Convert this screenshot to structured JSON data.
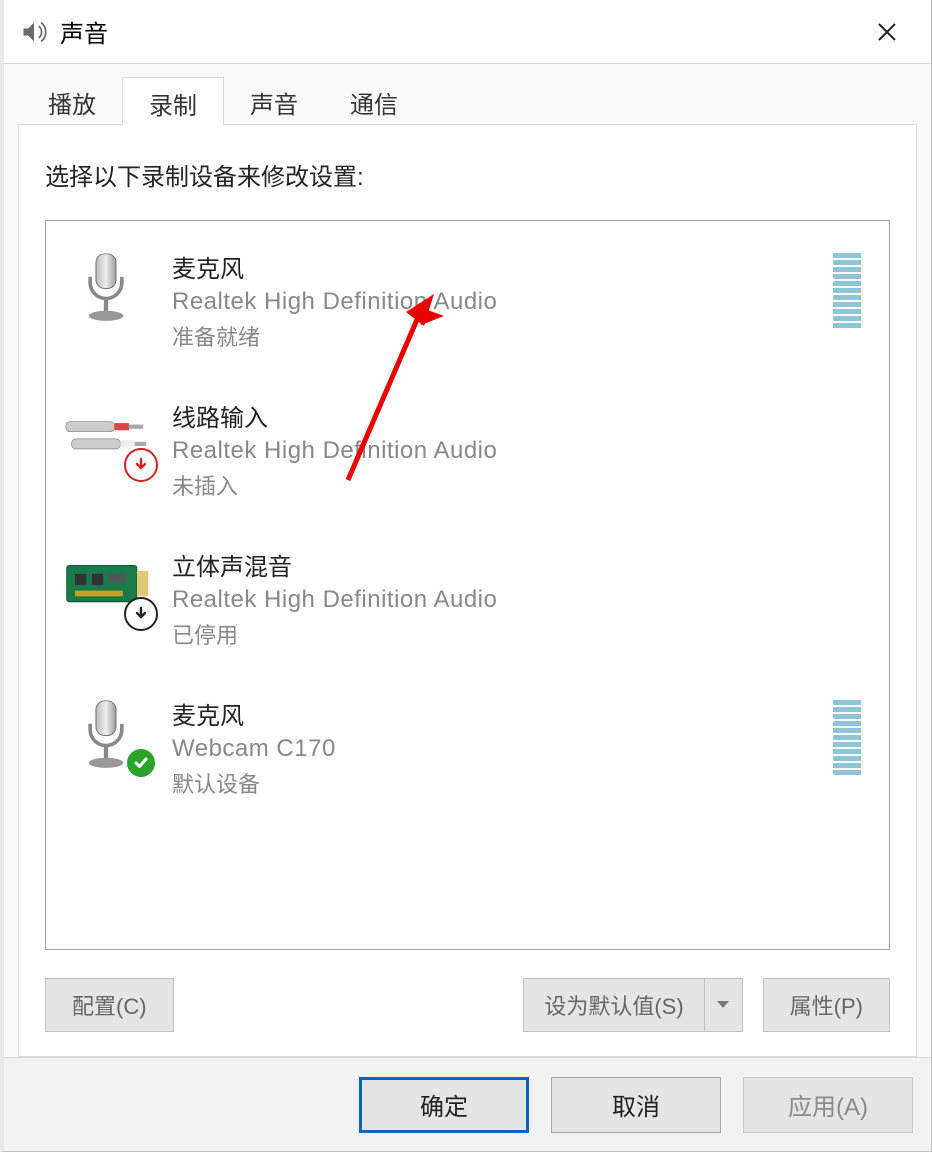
{
  "window": {
    "title": "声音",
    "icon": "sound-icon"
  },
  "tabs": [
    {
      "label": "播放",
      "active": false
    },
    {
      "label": "录制",
      "active": true
    },
    {
      "label": "声音",
      "active": false
    },
    {
      "label": "通信",
      "active": false
    }
  ],
  "panel": {
    "instructions": "选择以下录制设备来修改设置:"
  },
  "devices": [
    {
      "icon": "microphone-icon",
      "badge": null,
      "name": "麦克风",
      "driver": "Realtek High Definition Audio",
      "status": "准备就绪",
      "meter": true
    },
    {
      "icon": "line-in-icon",
      "badge": "unplugged",
      "name": "线路输入",
      "driver": "Realtek High Definition Audio",
      "status": "未插入",
      "meter": false
    },
    {
      "icon": "stereo-mix-icon",
      "badge": "disabled",
      "name": "立体声混音",
      "driver": "Realtek High Definition Audio",
      "status": "已停用",
      "meter": false
    },
    {
      "icon": "microphone-icon",
      "badge": "default",
      "name": "麦克风",
      "driver": "Webcam C170",
      "status": "默认设备",
      "meter": true
    }
  ],
  "panel_buttons": {
    "configure": "配置(C)",
    "set_default": "设为默认值(S)",
    "properties": "属性(P)"
  },
  "dialog_buttons": {
    "ok": "确定",
    "cancel": "取消",
    "apply": "应用(A)"
  }
}
